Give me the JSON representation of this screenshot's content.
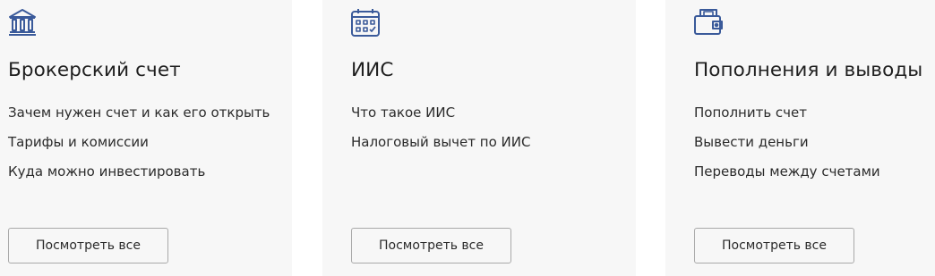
{
  "colors": {
    "card_background": "#f7f7f7",
    "icon_accent": "#3a5a9a",
    "button_border": "#a9a9a9"
  },
  "cards": [
    {
      "icon": "bank-icon",
      "title": "Брокерский счет",
      "links": [
        "Зачем нужен счет и как его открыть",
        "Тарифы и комиссии",
        "Куда можно инвестировать"
      ],
      "button_label": "Посмотреть все"
    },
    {
      "icon": "calendar-icon",
      "title": "ИИС",
      "links": [
        "Что такое ИИС",
        "Налоговый вычет по ИИС"
      ],
      "button_label": "Посмотреть все"
    },
    {
      "icon": "wallet-icon",
      "title": "Пополнения и выводы",
      "links": [
        "Пополнить счет",
        "Вывести деньги",
        "Переводы между счетами"
      ],
      "button_label": "Посмотреть все"
    }
  ]
}
